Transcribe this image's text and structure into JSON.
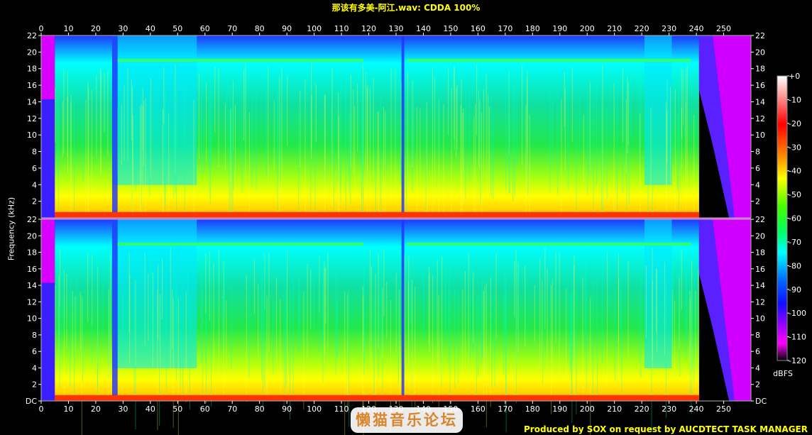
{
  "title": "那该有多美-阿江.wav: CDDA 100%",
  "credit": "Produced by SOX on request by AUCDTECT TASK MANAGER",
  "watermark": "懒猫音乐论坛",
  "chart_data": {
    "type": "heatmap",
    "ylabel": "Frequency (kHz)",
    "x_ticks": [
      0,
      10,
      20,
      30,
      40,
      50,
      60,
      70,
      80,
      90,
      100,
      110,
      120,
      130,
      140,
      150,
      160,
      170,
      180,
      190,
      200,
      210,
      220,
      230,
      240,
      250
    ],
    "xlim": [
      0,
      260
    ],
    "y_ticks": [
      "DC",
      "2",
      "4",
      "6",
      "8",
      "10",
      "12",
      "14",
      "16",
      "18",
      "20",
      "22"
    ],
    "ylim": [
      0,
      22
    ],
    "channels": 2,
    "colorbar": {
      "label": "dBFS",
      "ticks": [
        "+0",
        "-10",
        "-20",
        "-30",
        "-40",
        "-50",
        "-60",
        "-70",
        "-80",
        "-90",
        "-100",
        "-110",
        "-120"
      ],
      "range": [
        0,
        -120
      ]
    }
  }
}
